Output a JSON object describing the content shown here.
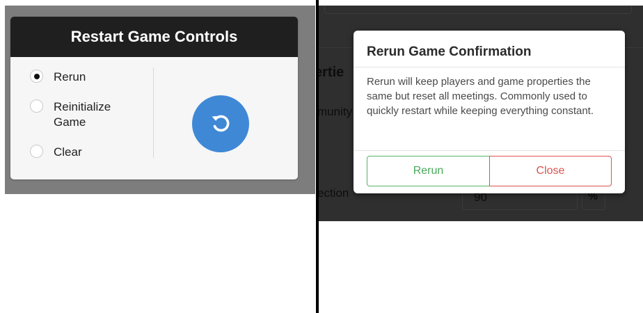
{
  "restart_panel": {
    "title": "Restart Game Controls",
    "options": [
      {
        "label": "Rerun",
        "checked": true
      },
      {
        "label": "Reinitialize Game",
        "checked": false
      },
      {
        "label": "Clear",
        "checked": false
      }
    ],
    "restart_button_icon": "restart-icon",
    "restart_button_color": "#3f88d6"
  },
  "background_page": {
    "partial_heading": "ertie",
    "partial_label_1": "munity",
    "partial_label_2": "ection",
    "input_value": "90",
    "input_suffix": "%"
  },
  "confirm_modal": {
    "title": "Rerun Game Confirmation",
    "message": "Rerun will keep players and game properties the same but reset all meetings. Commonly used to quickly restart while keeping everything constant.",
    "confirm_label": "Rerun",
    "cancel_label": "Close",
    "confirm_color": "#4aa85b",
    "cancel_color": "#d9534f"
  }
}
